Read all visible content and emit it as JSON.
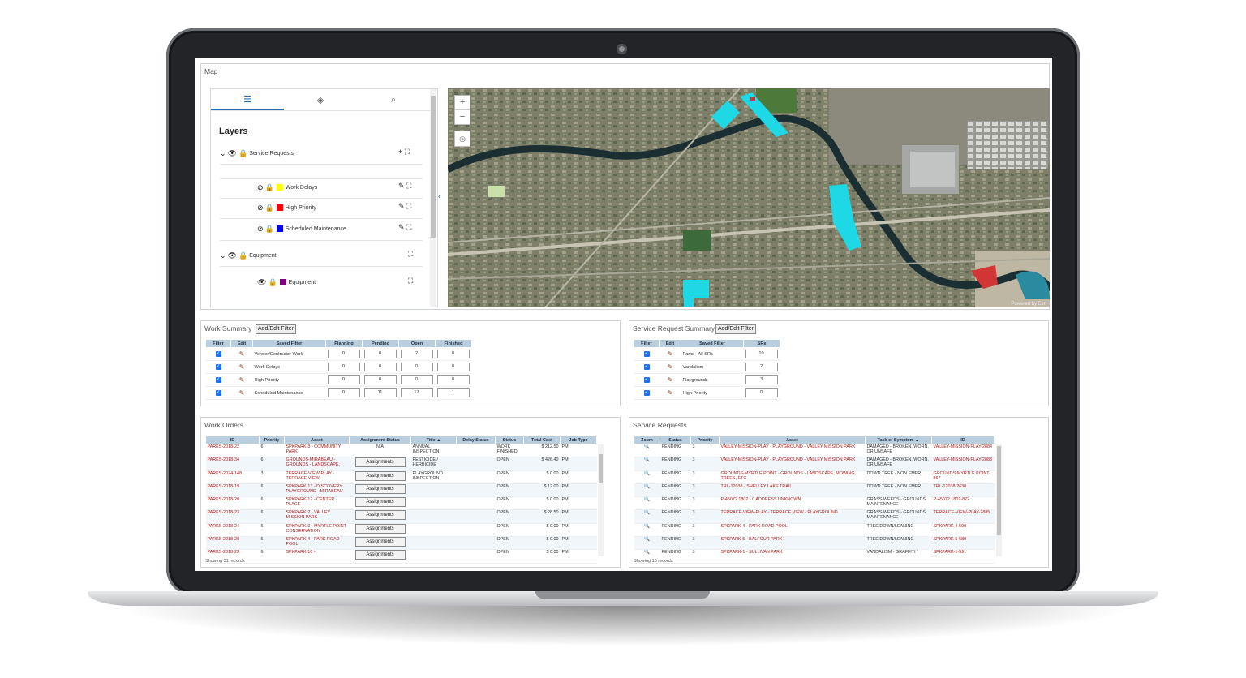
{
  "map_panel": {
    "title": "Map"
  },
  "layers": {
    "title": "Layers",
    "tabs": [
      {
        "icon": "list-icon"
      },
      {
        "icon": "layers-icon"
      },
      {
        "icon": "map-search-icon"
      }
    ],
    "groups": [
      {
        "name": "Service Requests",
        "items": [
          {
            "name": "Work Delays",
            "color": "#ffff00"
          },
          {
            "name": "High Priority",
            "color": "#ff0000"
          },
          {
            "name": "Scheduled Maintenance",
            "color": "#0000ff"
          }
        ]
      },
      {
        "name": "Equipment",
        "items": [
          {
            "name": "Equipment",
            "color": "#800080"
          }
        ]
      }
    ]
  },
  "map": {
    "attribution": "Powered by Esri",
    "zoom_in": "+",
    "zoom_out": "−"
  },
  "work_summary": {
    "title": "Work Summary",
    "filter_button": "Add/Edit Filter",
    "columns": [
      "Filter",
      "Edit",
      "Saved Filter",
      "Planning",
      "Pending",
      "Open",
      "Finished"
    ],
    "rows": [
      {
        "filter": "Vendor/Contractor Work",
        "planning": "0",
        "pending": "0",
        "open": "2",
        "finished": "0"
      },
      {
        "filter": "Work Delays",
        "planning": "0",
        "pending": "0",
        "open": "0",
        "finished": "0"
      },
      {
        "filter": "High Priority",
        "planning": "0",
        "pending": "0",
        "open": "0",
        "finished": "0"
      },
      {
        "filter": "Scheduled Maintenance",
        "planning": "0",
        "pending": "11",
        "open": "17",
        "finished": "1"
      }
    ]
  },
  "sr_summary": {
    "title": "Service Request Summary",
    "filter_button": "Add/Edit Filter",
    "columns": [
      "Filter",
      "Edit",
      "Saved Filter",
      "SRs"
    ],
    "rows": [
      {
        "filter": "Parks - All SRs",
        "srs": "10"
      },
      {
        "filter": "Vandalism",
        "srs": "2"
      },
      {
        "filter": "Playgrounds",
        "srs": "3"
      },
      {
        "filter": "High Priority",
        "srs": "0"
      }
    ]
  },
  "work_orders": {
    "title": "Work Orders",
    "columns": [
      "ID",
      "Priority",
      "Asset",
      "Assignment Status",
      "Title",
      "Delay Status",
      "Status",
      "Total Cost",
      "Job Type"
    ],
    "sort_indicator": "▲",
    "assign_label": "Assignments",
    "rows": [
      {
        "id": "PARKS-2018-22",
        "priority": "6",
        "asset": "SPKPARK-3 - COMMUNITY PARK",
        "assignment": "N/A",
        "title": "ANNUAL INSPECTION",
        "delay": "",
        "status": "WORK FINISHED",
        "cost": "$ 212.50",
        "job": "PM"
      },
      {
        "id": "PARKS-2018-34",
        "priority": "6",
        "asset": "GROUNDS-MIRABEAU - GROUNDS - LANDSCAPE,",
        "assignment": "Assignments",
        "title": "PESTICIDE / HERBICIDE",
        "delay": "",
        "status": "OPEN",
        "cost": "$ 426.40",
        "job": "PM"
      },
      {
        "id": "PARKS-2024-148",
        "priority": "3",
        "asset": "TERRACE-VIEW-PLAY - TERRACE VIEW -",
        "assignment": "Assignments",
        "title": "PLAYGROUND INSPECTION",
        "delay": "",
        "status": "OPEN",
        "cost": "$ 0.00",
        "job": "PM"
      },
      {
        "id": "PARKS-2018-19",
        "priority": "6",
        "asset": "SPKPARK-13 - DISCOVERY PLAYGROUND - MIRABEAU",
        "assignment": "Assignments",
        "title": "",
        "delay": "",
        "status": "OPEN",
        "cost": "$ 12.00",
        "job": "PM"
      },
      {
        "id": "PARKS-2018-20",
        "priority": "6",
        "asset": "SPKPARK-12 - CENTER PLACE",
        "assignment": "Assignments",
        "title": "",
        "delay": "",
        "status": "OPEN",
        "cost": "$ 0.00",
        "job": "PM"
      },
      {
        "id": "PARKS-2018-23",
        "priority": "6",
        "asset": "SPKPARK-2 - VALLEY MISSION PARK",
        "assignment": "Assignments",
        "title": "",
        "delay": "",
        "status": "OPEN",
        "cost": "$ 28.50",
        "job": "PM"
      },
      {
        "id": "PARKS-2018-24",
        "priority": "6",
        "asset": "SPKPARK-0 - MYRTLE POINT CONSERVATION",
        "assignment": "Assignments",
        "title": "",
        "delay": "",
        "status": "OPEN",
        "cost": "$ 0.00",
        "job": "PM"
      },
      {
        "id": "PARKS-2018-28",
        "priority": "6",
        "asset": "SPKPARK-4 - PARK ROAD POOL",
        "assignment": "Assignments",
        "title": "",
        "delay": "",
        "status": "OPEN",
        "cost": "$ 0.00",
        "job": "PM"
      },
      {
        "id": "PARKS-2018-29",
        "priority": "6",
        "asset": "SPKPARK-10 -",
        "assignment": "Assignments",
        "title": "",
        "delay": "",
        "status": "OPEN",
        "cost": "$ 0.00",
        "job": "PM"
      }
    ],
    "footer": "Showing 31 records"
  },
  "service_requests": {
    "title": "Service Requests",
    "columns": [
      "Zoom",
      "Status",
      "Priority",
      "Asset",
      "Task or Symptom",
      "ID"
    ],
    "sort_indicator": "▲",
    "rows": [
      {
        "status": "PENDING",
        "priority": "3",
        "asset": "VALLEY-MISSION-PLAY - PLAYGROUND - VALLEY MISSION PARK",
        "task": "DAMAGED - BROKEN, WORN, OR UNSAFE",
        "id": "VALLEY-MISSION-PLAY-2884"
      },
      {
        "status": "PENDING",
        "priority": "3",
        "asset": "VALLEY-MISSION-PLAY - PLAYGROUND - VALLEY MISSION PARK",
        "task": "DAMAGED - BROKEN, WORN, OR UNSAFE",
        "id": "VALLEY-MISSION-PLAY-2888"
      },
      {
        "status": "PENDING",
        "priority": "3",
        "asset": "GROUNDS-MYRTLE POINT - GROUNDS - LANDSCAPE, MOWING, TREES, ETC",
        "task": "DOWN TREE - NON EMER",
        "id": "GROUNDS-MYRTLE POINT-867"
      },
      {
        "status": "PENDING",
        "priority": "3",
        "asset": "TRL-12038 - SHELLEY LAKE TRAIL",
        "task": "DOWN TREE - NON EMER",
        "id": "TRL-12038-2630"
      },
      {
        "status": "PENDING",
        "priority": "3",
        "asset": "P-45072.1802 - 0 ADDRESS UNKNOWN",
        "task": "GRASS/WEEDS - GROUNDS MAINTENANCE",
        "id": "P-45072.1802-822"
      },
      {
        "status": "PENDING",
        "priority": "3",
        "asset": "TERRACE-VIEW-PLAY - TERRACE VIEW - PLAYGROUND",
        "task": "GRASS/WEEDS - GROUNDS MAINTENANCE",
        "id": "TERRACE-VIEW-PLAY-2885"
      },
      {
        "status": "PENDING",
        "priority": "3",
        "asset": "SPKPARK-4 - PARK ROAD POOL",
        "task": "TREE DOWN/LEANING",
        "id": "SPKPARK-4-590"
      },
      {
        "status": "PENDING",
        "priority": "3",
        "asset": "SPKPARK-5 - BALFOUR PARK",
        "task": "TREE DOWN/LEANING",
        "id": "SPKPARK-5-589"
      },
      {
        "status": "PENDING",
        "priority": "3",
        "asset": "SPKPARK-1 - SULLIVAN PARK",
        "task": "VANDALISM - GRAFFITI /",
        "id": "SPKPARK-1-591"
      }
    ],
    "footer": "Showing 10 records"
  },
  "colors": {
    "link_red": "#b31b1b",
    "header_blue": "#b9cfe0",
    "accent_blue": "#1c6fbf",
    "highlight_cyan": "#1ed8e6"
  }
}
